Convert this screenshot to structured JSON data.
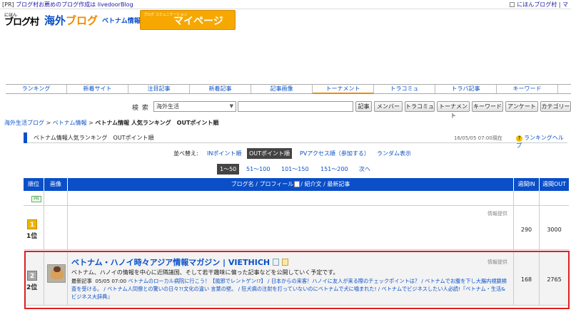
{
  "topbar": {
    "pr": "[PR]",
    "pr_link": "ブログ村お薦めのブログ作成は livedoorBlog",
    "right": "にほんブログ村",
    "right_more": "マ"
  },
  "logos": {
    "blogmura_small": "にほん",
    "blogmura": "ブログ村",
    "kaigai_a": "海外",
    "kaigai_b": "ブログ",
    "vietnam": "ベトナム情報",
    "mypage_small": "ブログ コミュニケーション",
    "mypage": "マイページ"
  },
  "nav": [
    "ランキング",
    "新着サイト",
    "注目記事",
    "新着記事",
    "記事画像",
    "トーナメント",
    "トラコミュ",
    "トラバ記事",
    "キーワード"
  ],
  "search": {
    "label": "検 索",
    "selected": "海外生活",
    "buttons": [
      "記事",
      "メンバー",
      "トラコミュ",
      "トーナメント",
      "キーワード",
      "アンケート",
      "カテゴリー"
    ]
  },
  "breadcrumb": {
    "c1": "海外生活ブログ",
    "sep": " > ",
    "c2": "ベトナム情報",
    "current": "ベトナム情報 人気ランキング　OUTポイント順"
  },
  "section": {
    "title": "ベトナム情報人気ランキング　OUTポイント順",
    "date": "16/05/05 07:00現在",
    "help": "ランキングヘルプ",
    "help_icon": "?"
  },
  "sort": {
    "label": "並べ替え:",
    "options": [
      "INポイント順",
      "OUTポイント順",
      "PVアクセス順（参加する）",
      "ランダム表示"
    ]
  },
  "pager": [
    "1〜50",
    "51〜100",
    "101〜150",
    "151〜200",
    "次へ"
  ],
  "table": {
    "headers": {
      "rank": "順位",
      "image": "画像",
      "blog_a": "ブログ名 / プロフィール",
      "blog_b": "/ 紹介文 / 最新記事",
      "week_in": "週間IN",
      "week_out": "週間OUT"
    },
    "pr_badge": "PR",
    "rows": [
      {
        "rank_num": "1",
        "rank": "1位",
        "provide": "情報提供",
        "in": "290",
        "out": "3000"
      },
      {
        "rank_num": "2",
        "rank": "2位",
        "provide": "情報提供",
        "title": "ベトナム・ハノイ時々アジア情報マガジン | VIETHICH",
        "desc": "ベトナム、ハノイの情報を中心に近隣諸国、そして若干趣味に偏った記事などを公開していく予定です。",
        "latest_label": "最新記事",
        "latest_date": "05/05 07:00",
        "latest_text": "ベトナムのローカル病院に行こう！【風邪でレントゲン!?】 / 日本からの来客！ハノイに友人が来る際のチェックポイントは？ / ベトナムでお腹を下し大腸内視鏡検査を受ける。 / ベトナム人同僚との驚いの日々?!文化の違い 言葉の壁。 / 狂犬病の注射を打っていないのにベトナムで犬に噛まれた! / ベトナムでビジネスしたい人必読!『ベトナム・生活&ビジネス大辞典』",
        "in": "168",
        "out": "2765"
      }
    ]
  }
}
